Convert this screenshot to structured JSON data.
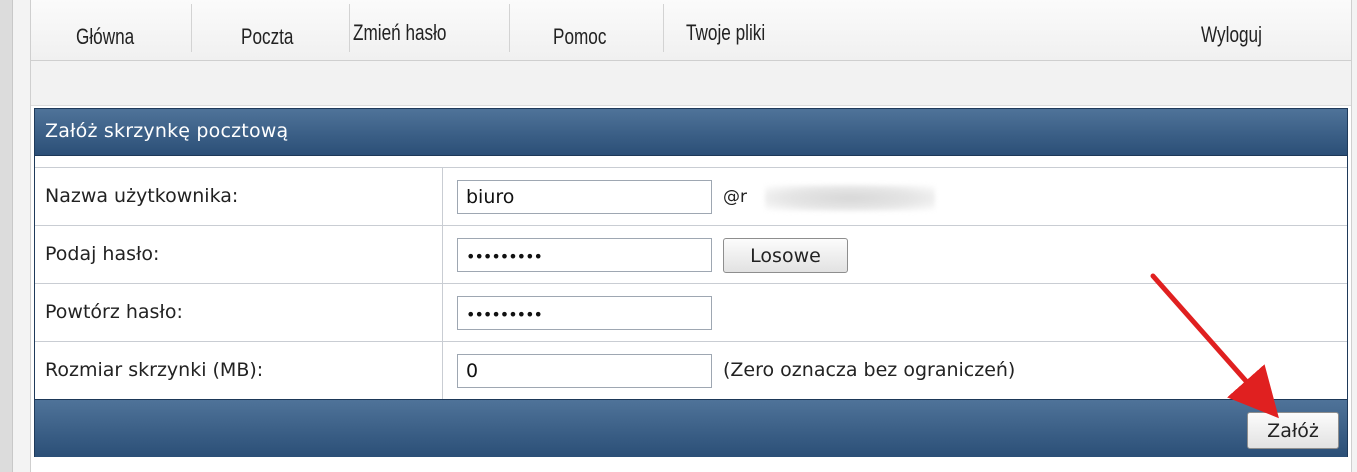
{
  "nav": {
    "items": [
      {
        "label": "Główna"
      },
      {
        "label": "Poczta"
      },
      {
        "label": "Zmień hasło"
      },
      {
        "label": "Pomoc"
      },
      {
        "label": "Twoje pliki"
      }
    ],
    "logout": "Wyloguj"
  },
  "form": {
    "title": "Załóż skrzynkę pocztową",
    "username": {
      "label": "Nazwa użytkownika:",
      "value": "biuro",
      "suffix": "@r"
    },
    "password": {
      "label": "Podaj hasło:",
      "value": "•••••••••",
      "random_button": "Losowe"
    },
    "password_repeat": {
      "label": "Powtórz hasło:",
      "value": "•••••••••"
    },
    "size": {
      "label": "Rozmiar skrzynki (MB):",
      "value": "0",
      "note": "(Zero oznacza bez ograniczeń)"
    },
    "submit": "Załóż"
  },
  "colors": {
    "header_blue": "#2b4f77",
    "arrow_red": "#e02020"
  }
}
